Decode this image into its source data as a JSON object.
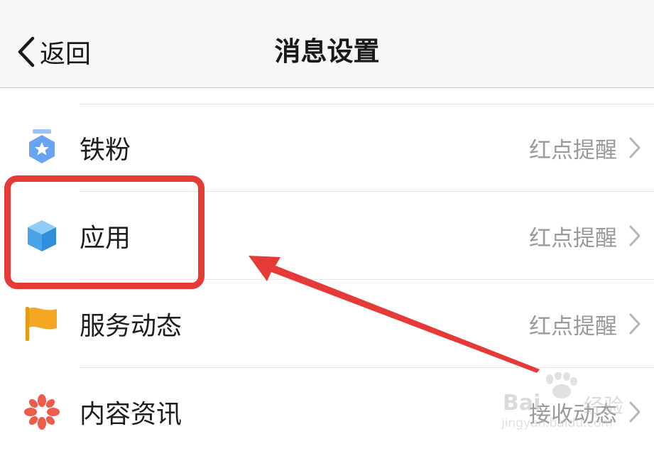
{
  "navbar": {
    "back_label": "返回",
    "title": "消息设置"
  },
  "rows": [
    {
      "label": "铁粉",
      "value": "红点提醒",
      "icon": "fan-badge-icon"
    },
    {
      "label": "应用",
      "value": "红点提醒",
      "icon": "cube-icon"
    },
    {
      "label": "服务动态",
      "value": "红点提醒",
      "icon": "flag-icon"
    },
    {
      "label": "内容资讯",
      "value": "接收动态",
      "icon": "flower-icon"
    }
  ],
  "watermark": {
    "brand": "Bai",
    "name": "经验",
    "url": "jingyan.baidu.com"
  },
  "colors": {
    "highlight": "#e53a35",
    "badge_blue": "#6aa3f2",
    "cube_blue": "#4aa3e8",
    "flag_orange": "#f5a623",
    "flower_red": "#ef5b4c"
  }
}
